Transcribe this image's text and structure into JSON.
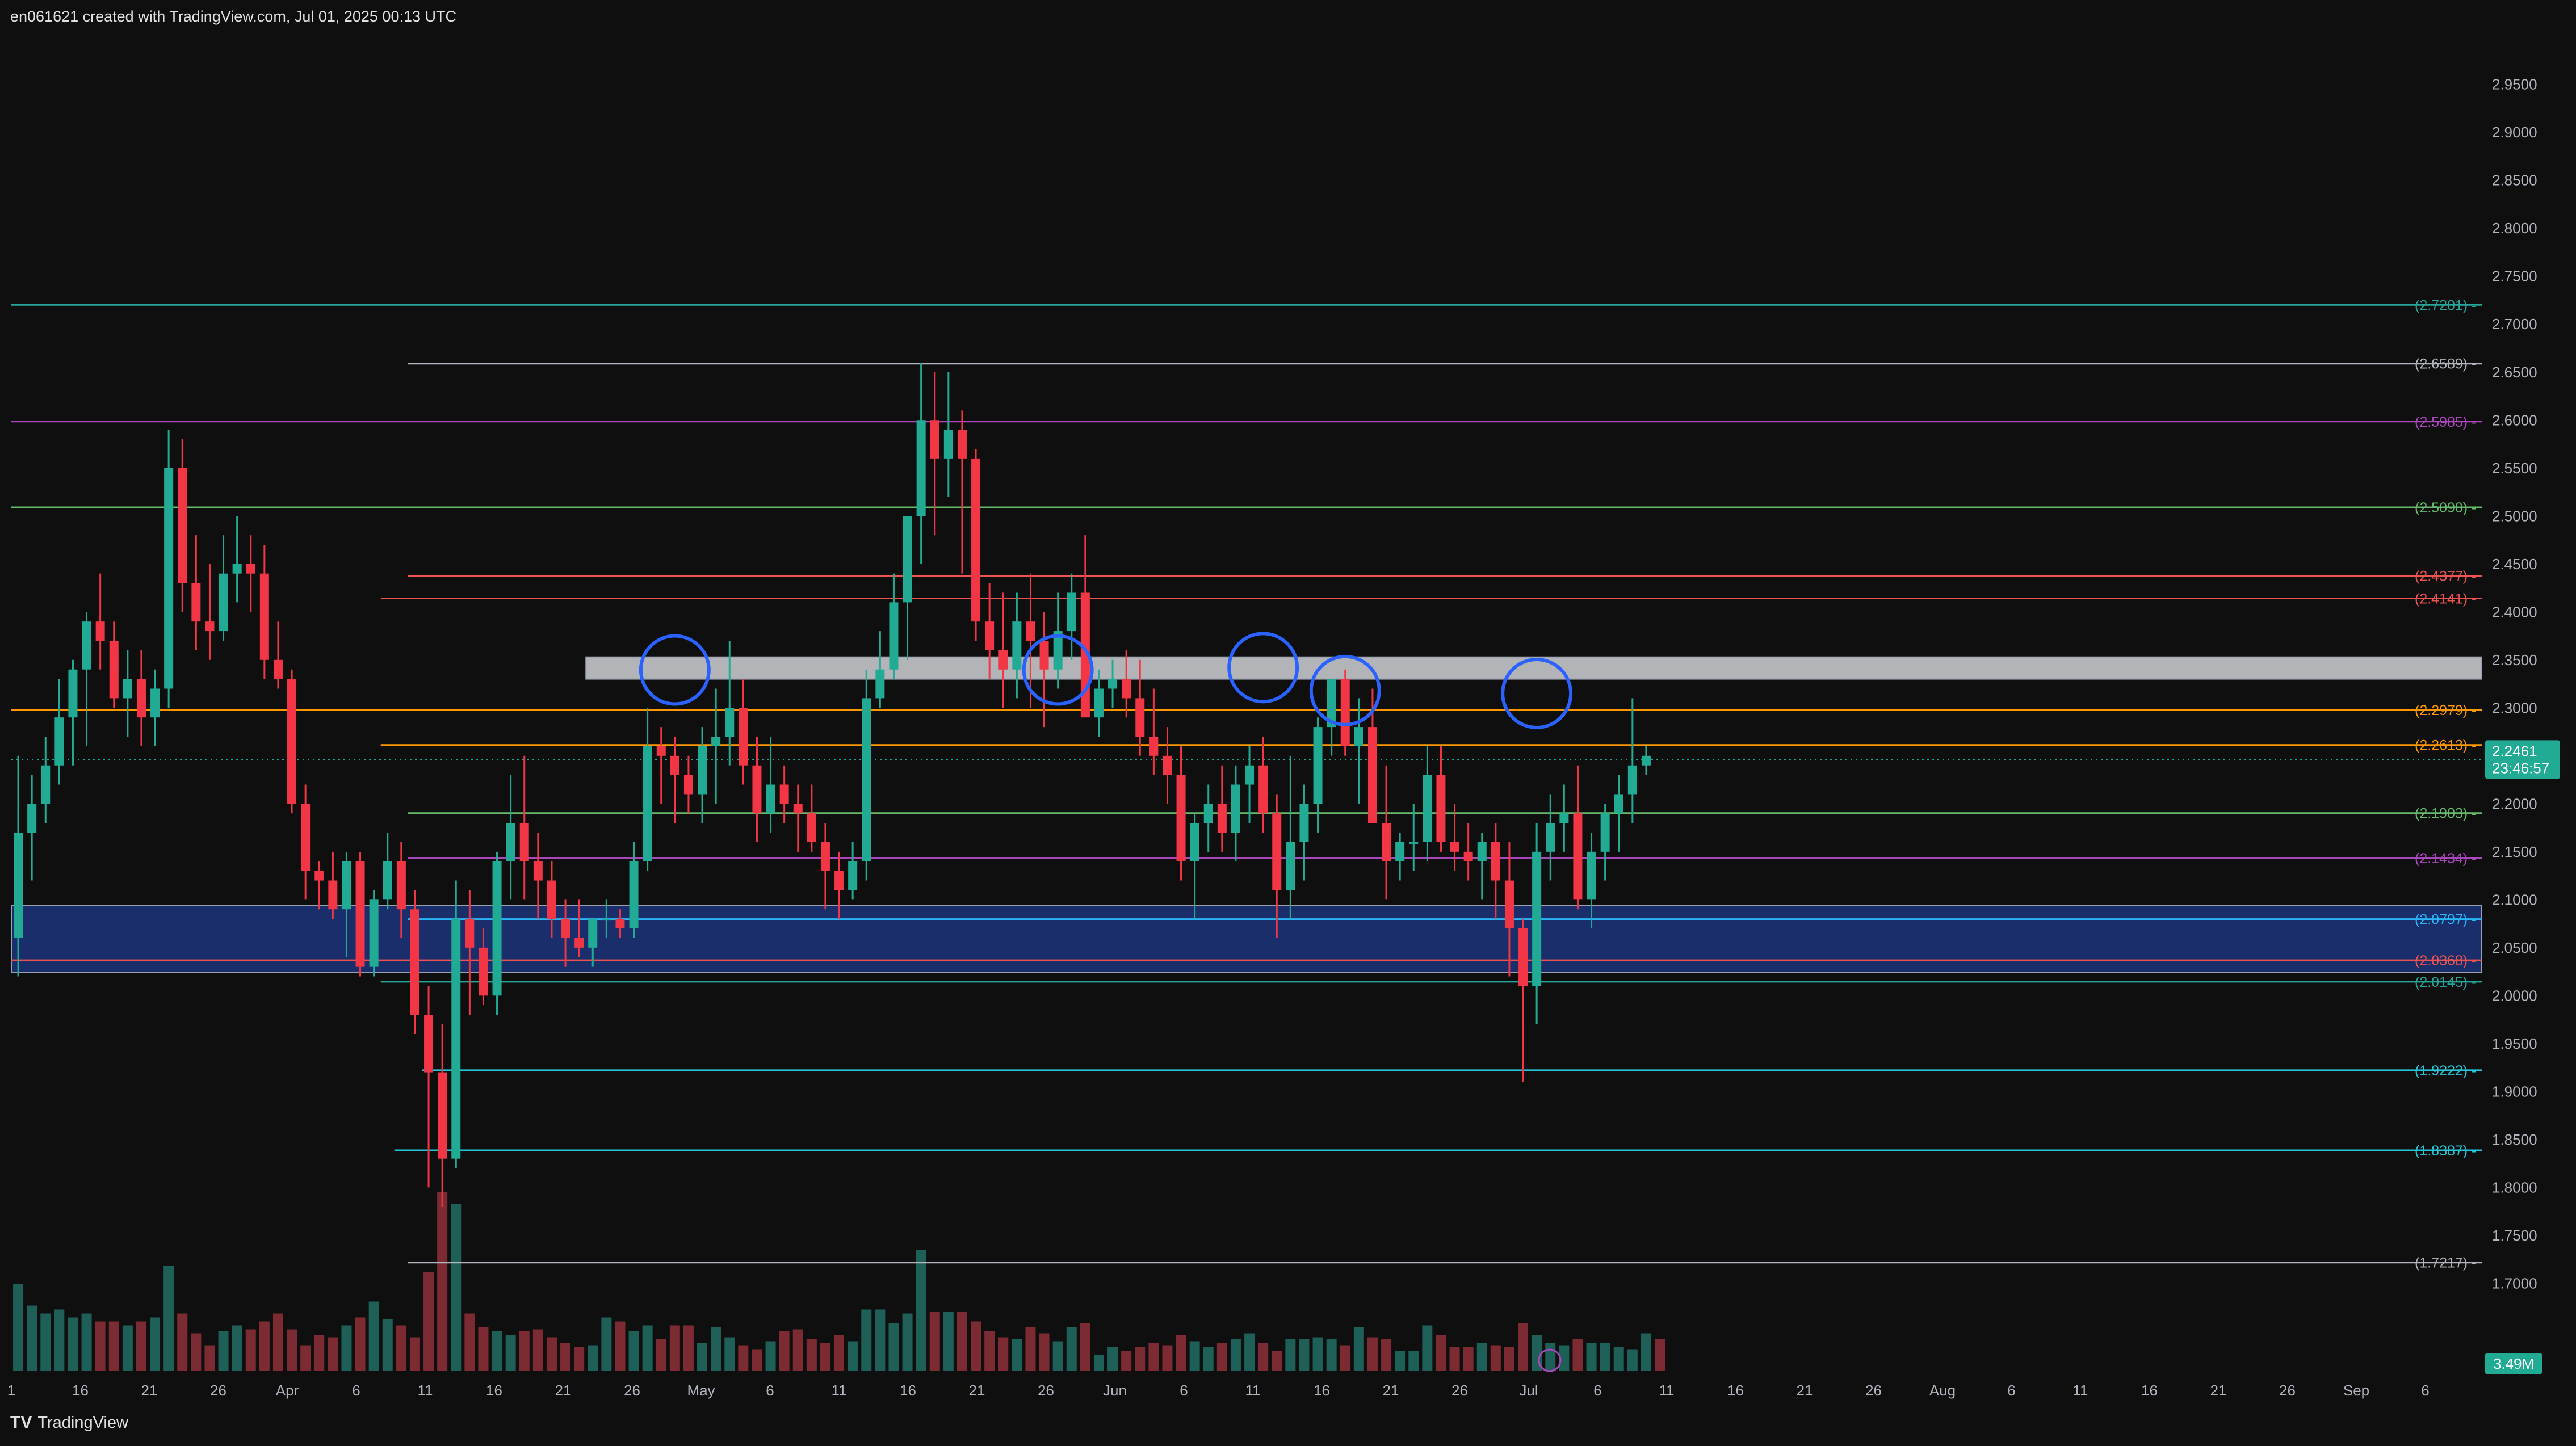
{
  "header": {
    "text": "en061621 created with TradingView.com, Jul 01, 2025 00:13 UTC"
  },
  "footer": {
    "logo": "TV",
    "brand": "TradingView"
  },
  "colors": {
    "up": "#22ab94",
    "down": "#f23645",
    "volume_up": "#1e5f57",
    "volume_down": "#7c2b33",
    "grid_text": "#b2b5be",
    "circle": "#2962ff"
  },
  "chart_data": {
    "type": "candlestick",
    "ylim": [
      1.66,
      2.98
    ],
    "y_ticks": [
      "2.9500",
      "2.9000",
      "2.8500",
      "2.8000",
      "2.7500",
      "2.7000",
      "2.6500",
      "2.6000",
      "2.5500",
      "2.5000",
      "2.4500",
      "2.4000",
      "2.3500",
      "2.3000",
      "2.2500",
      "2.2000",
      "2.1500",
      "2.1000",
      "2.0500",
      "2.0000",
      "1.9500",
      "1.9000",
      "1.8500",
      "1.8000",
      "1.7500",
      "1.7000"
    ],
    "x_ticks": [
      "1",
      "16",
      "21",
      "26",
      "Apr",
      "6",
      "11",
      "16",
      "21",
      "26",
      "May",
      "6",
      "11",
      "16",
      "21",
      "26",
      "Jun",
      "6",
      "11",
      "16",
      "21",
      "26",
      "Jul",
      "6",
      "11",
      "16",
      "21",
      "26",
      "Aug",
      "6",
      "11",
      "16",
      "21",
      "26",
      "Sep",
      "6"
    ],
    "levels": [
      {
        "label": "(2.7201)",
        "value": 2.7201,
        "color": "#26a69a",
        "start_day": 0
      },
      {
        "label": "(2.6589)",
        "value": 2.6589,
        "color": "#b2b5be",
        "start_day": 29
      },
      {
        "label": "(2.5985)",
        "value": 2.5985,
        "color": "#ab47bc",
        "start_day": 0
      },
      {
        "label": "(2.5090)",
        "value": 2.509,
        "color": "#66bb6a",
        "start_day": 0
      },
      {
        "label": "(2.4377)",
        "value": 2.4377,
        "color": "#ef5350",
        "start_day": 29
      },
      {
        "label": "(2.4141)",
        "value": 2.4141,
        "color": "#ef5350",
        "start_day": 27
      },
      {
        "label": "(2.2979)",
        "value": 2.2979,
        "color": "#ff9800",
        "start_day": 0
      },
      {
        "label": "(2.2613)",
        "value": 2.2613,
        "color": "#ff9800",
        "start_day": 27
      },
      {
        "label": "(2.1903)",
        "value": 2.1903,
        "color": "#66bb6a",
        "start_day": 29
      },
      {
        "label": "(2.1434)",
        "value": 2.1434,
        "color": "#ab47bc",
        "start_day": 29
      },
      {
        "label": "(2.0797)",
        "value": 2.0797,
        "color": "#29b6f6",
        "start_day": 29
      },
      {
        "label": "(2.0368)",
        "value": 2.0368,
        "color": "#ef5350",
        "start_day": 0
      },
      {
        "label": "(2.0145)",
        "value": 2.0145,
        "color": "#26a69a",
        "start_day": 27
      },
      {
        "label": "(1.9222)",
        "value": 1.9222,
        "color": "#26c6da",
        "start_day": 30
      },
      {
        "label": "(1.8387)",
        "value": 1.8387,
        "color": "#26c6da",
        "start_day": 28
      },
      {
        "label": "(1.7217)",
        "value": 1.7217,
        "color": "#b2b5be",
        "start_day": 29
      }
    ],
    "zones": [
      {
        "from": 2.33,
        "to": 2.353,
        "start_day": 42,
        "fill": "#cfd1d6",
        "opacity": 0.85
      },
      {
        "from": 2.024,
        "to": 2.094,
        "start_day": 0,
        "fill": "#1e3a8a",
        "opacity": 0.75
      }
    ],
    "circles": [
      {
        "day": 48,
        "price": 2.3395
      },
      {
        "day": 76,
        "price": 2.3395
      },
      {
        "day": 91,
        "price": 2.342
      },
      {
        "day": 97,
        "price": 2.318
      },
      {
        "day": 111,
        "price": 2.315
      }
    ],
    "current_price": {
      "value": "2.2461",
      "countdown": "23:46:57",
      "price": 2.2461
    },
    "volume_label": "3.49M",
    "candles": [
      [
        2.06,
        2.25,
        2.02,
        2.17
      ],
      [
        2.17,
        2.23,
        2.12,
        2.2
      ],
      [
        2.2,
        2.27,
        2.18,
        2.24
      ],
      [
        2.24,
        2.33,
        2.22,
        2.29
      ],
      [
        2.29,
        2.35,
        2.24,
        2.34
      ],
      [
        2.34,
        2.4,
        2.26,
        2.39
      ],
      [
        2.39,
        2.44,
        2.34,
        2.37
      ],
      [
        2.37,
        2.39,
        2.3,
        2.31
      ],
      [
        2.31,
        2.36,
        2.27,
        2.33
      ],
      [
        2.33,
        2.36,
        2.26,
        2.29
      ],
      [
        2.29,
        2.34,
        2.26,
        2.32
      ],
      [
        2.32,
        2.59,
        2.3,
        2.55
      ],
      [
        2.55,
        2.58,
        2.4,
        2.43
      ],
      [
        2.43,
        2.48,
        2.36,
        2.39
      ],
      [
        2.39,
        2.45,
        2.35,
        2.38
      ],
      [
        2.38,
        2.48,
        2.37,
        2.44
      ],
      [
        2.44,
        2.5,
        2.41,
        2.45
      ],
      [
        2.45,
        2.48,
        2.4,
        2.44
      ],
      [
        2.44,
        2.47,
        2.33,
        2.35
      ],
      [
        2.35,
        2.39,
        2.32,
        2.33
      ],
      [
        2.33,
        2.34,
        2.19,
        2.2
      ],
      [
        2.2,
        2.22,
        2.1,
        2.13
      ],
      [
        2.13,
        2.14,
        2.09,
        2.12
      ],
      [
        2.12,
        2.15,
        2.08,
        2.09
      ],
      [
        2.09,
        2.15,
        2.04,
        2.14
      ],
      [
        2.14,
        2.15,
        2.02,
        2.03
      ],
      [
        2.03,
        2.11,
        2.02,
        2.1
      ],
      [
        2.1,
        2.17,
        2.09,
        2.14
      ],
      [
        2.14,
        2.16,
        2.06,
        2.09
      ],
      [
        2.09,
        2.11,
        1.96,
        1.98
      ],
      [
        1.98,
        2.01,
        1.8,
        1.92
      ],
      [
        1.92,
        1.97,
        1.78,
        1.83
      ],
      [
        1.83,
        2.12,
        1.82,
        2.08
      ],
      [
        2.08,
        2.11,
        1.98,
        2.05
      ],
      [
        2.05,
        2.07,
        1.99,
        2.0
      ],
      [
        2.0,
        2.15,
        1.98,
        2.14
      ],
      [
        2.14,
        2.23,
        2.1,
        2.18
      ],
      [
        2.18,
        2.25,
        2.1,
        2.14
      ],
      [
        2.14,
        2.17,
        2.08,
        2.12
      ],
      [
        2.12,
        2.14,
        2.06,
        2.08
      ],
      [
        2.08,
        2.1,
        2.03,
        2.06
      ],
      [
        2.06,
        2.1,
        2.04,
        2.05
      ],
      [
        2.05,
        2.08,
        2.03,
        2.08
      ],
      [
        2.08,
        2.1,
        2.06,
        2.08
      ],
      [
        2.08,
        2.09,
        2.06,
        2.07
      ],
      [
        2.07,
        2.16,
        2.06,
        2.14
      ],
      [
        2.14,
        2.3,
        2.13,
        2.26
      ],
      [
        2.26,
        2.28,
        2.2,
        2.25
      ],
      [
        2.25,
        2.27,
        2.18,
        2.23
      ],
      [
        2.23,
        2.25,
        2.19,
        2.21
      ],
      [
        2.21,
        2.28,
        2.18,
        2.26
      ],
      [
        2.26,
        2.32,
        2.2,
        2.27
      ],
      [
        2.27,
        2.37,
        2.24,
        2.3
      ],
      [
        2.3,
        2.33,
        2.22,
        2.24
      ],
      [
        2.24,
        2.27,
        2.16,
        2.19
      ],
      [
        2.19,
        2.27,
        2.17,
        2.22
      ],
      [
        2.22,
        2.24,
        2.18,
        2.2
      ],
      [
        2.2,
        2.22,
        2.15,
        2.19
      ],
      [
        2.19,
        2.22,
        2.15,
        2.16
      ],
      [
        2.16,
        2.18,
        2.09,
        2.13
      ],
      [
        2.13,
        2.15,
        2.08,
        2.11
      ],
      [
        2.11,
        2.16,
        2.1,
        2.14
      ],
      [
        2.14,
        2.34,
        2.12,
        2.31
      ],
      [
        2.31,
        2.38,
        2.3,
        2.34
      ],
      [
        2.34,
        2.44,
        2.33,
        2.41
      ],
      [
        2.41,
        2.5,
        2.35,
        2.5
      ],
      [
        2.5,
        2.66,
        2.45,
        2.6
      ],
      [
        2.6,
        2.65,
        2.48,
        2.56
      ],
      [
        2.56,
        2.65,
        2.52,
        2.59
      ],
      [
        2.59,
        2.61,
        2.44,
        2.56
      ],
      [
        2.56,
        2.57,
        2.37,
        2.39
      ],
      [
        2.39,
        2.43,
        2.33,
        2.36
      ],
      [
        2.36,
        2.42,
        2.3,
        2.34
      ],
      [
        2.34,
        2.42,
        2.31,
        2.39
      ],
      [
        2.39,
        2.44,
        2.3,
        2.37
      ],
      [
        2.37,
        2.4,
        2.28,
        2.34
      ],
      [
        2.34,
        2.42,
        2.32,
        2.38
      ],
      [
        2.38,
        2.44,
        2.35,
        2.42
      ],
      [
        2.42,
        2.48,
        2.3,
        2.29
      ],
      [
        2.29,
        2.34,
        2.27,
        2.32
      ],
      [
        2.32,
        2.35,
        2.3,
        2.33
      ],
      [
        2.33,
        2.36,
        2.29,
        2.31
      ],
      [
        2.31,
        2.35,
        2.25,
        2.27
      ],
      [
        2.27,
        2.32,
        2.23,
        2.25
      ],
      [
        2.25,
        2.28,
        2.2,
        2.23
      ],
      [
        2.23,
        2.26,
        2.12,
        2.14
      ],
      [
        2.14,
        2.19,
        2.08,
        2.18
      ],
      [
        2.18,
        2.22,
        2.15,
        2.2
      ],
      [
        2.2,
        2.24,
        2.15,
        2.17
      ],
      [
        2.17,
        2.24,
        2.14,
        2.22
      ],
      [
        2.22,
        2.26,
        2.18,
        2.24
      ],
      [
        2.24,
        2.27,
        2.17,
        2.19
      ],
      [
        2.19,
        2.21,
        2.06,
        2.11
      ],
      [
        2.11,
        2.25,
        2.08,
        2.16
      ],
      [
        2.16,
        2.22,
        2.12,
        2.2
      ],
      [
        2.2,
        2.29,
        2.17,
        2.28
      ],
      [
        2.28,
        2.33,
        2.25,
        2.33
      ],
      [
        2.33,
        2.34,
        2.25,
        2.26
      ],
      [
        2.26,
        2.31,
        2.2,
        2.28
      ],
      [
        2.28,
        2.32,
        2.18,
        2.18
      ],
      [
        2.18,
        2.24,
        2.1,
        2.14
      ],
      [
        2.14,
        2.17,
        2.12,
        2.16
      ],
      [
        2.16,
        2.2,
        2.13,
        2.16
      ],
      [
        2.16,
        2.26,
        2.14,
        2.23
      ],
      [
        2.23,
        2.26,
        2.15,
        2.16
      ],
      [
        2.16,
        2.2,
        2.13,
        2.15
      ],
      [
        2.15,
        2.18,
        2.12,
        2.14
      ],
      [
        2.14,
        2.17,
        2.1,
        2.16
      ],
      [
        2.16,
        2.18,
        2.08,
        2.12
      ],
      [
        2.12,
        2.16,
        2.02,
        2.07
      ],
      [
        2.07,
        2.08,
        1.91,
        2.01
      ],
      [
        2.01,
        2.18,
        1.97,
        2.15
      ],
      [
        2.15,
        2.21,
        2.12,
        2.18
      ],
      [
        2.18,
        2.22,
        2.15,
        2.19
      ],
      [
        2.19,
        2.24,
        2.09,
        2.1
      ],
      [
        2.1,
        2.17,
        2.07,
        2.15
      ],
      [
        2.15,
        2.2,
        2.12,
        2.19
      ],
      [
        2.19,
        2.23,
        2.15,
        2.21
      ],
      [
        2.21,
        2.31,
        2.18,
        2.24
      ],
      [
        2.24,
        2.26,
        2.23,
        2.25
      ]
    ],
    "volumes": [
      0.44,
      0.33,
      0.29,
      0.31,
      0.27,
      0.29,
      0.25,
      0.25,
      0.23,
      0.25,
      0.27,
      0.53,
      0.29,
      0.19,
      0.13,
      0.2,
      0.23,
      0.21,
      0.25,
      0.29,
      0.21,
      0.13,
      0.18,
      0.17,
      0.23,
      0.27,
      0.35,
      0.26,
      0.23,
      0.17,
      0.5,
      0.9,
      0.84,
      0.29,
      0.22,
      0.2,
      0.18,
      0.2,
      0.21,
      0.17,
      0.14,
      0.12,
      0.13,
      0.27,
      0.25,
      0.2,
      0.23,
      0.16,
      0.23,
      0.23,
      0.14,
      0.22,
      0.17,
      0.13,
      0.11,
      0.15,
      0.2,
      0.21,
      0.16,
      0.14,
      0.18,
      0.15,
      0.31,
      0.31,
      0.24,
      0.29,
      0.61,
      0.3,
      0.3,
      0.3,
      0.25,
      0.2,
      0.17,
      0.16,
      0.22,
      0.19,
      0.15,
      0.22,
      0.24,
      0.08,
      0.12,
      0.1,
      0.12,
      0.14,
      0.13,
      0.18,
      0.15,
      0.12,
      0.14,
      0.16,
      0.19,
      0.14,
      0.1,
      0.16,
      0.16,
      0.17,
      0.16,
      0.13,
      0.22,
      0.17,
      0.16,
      0.1,
      0.1,
      0.23,
      0.18,
      0.12,
      0.12,
      0.14,
      0.13,
      0.12,
      0.24,
      0.18,
      0.14,
      0.13,
      0.16,
      0.14,
      0.14,
      0.12,
      0.11,
      0.19,
      0.16
    ]
  }
}
